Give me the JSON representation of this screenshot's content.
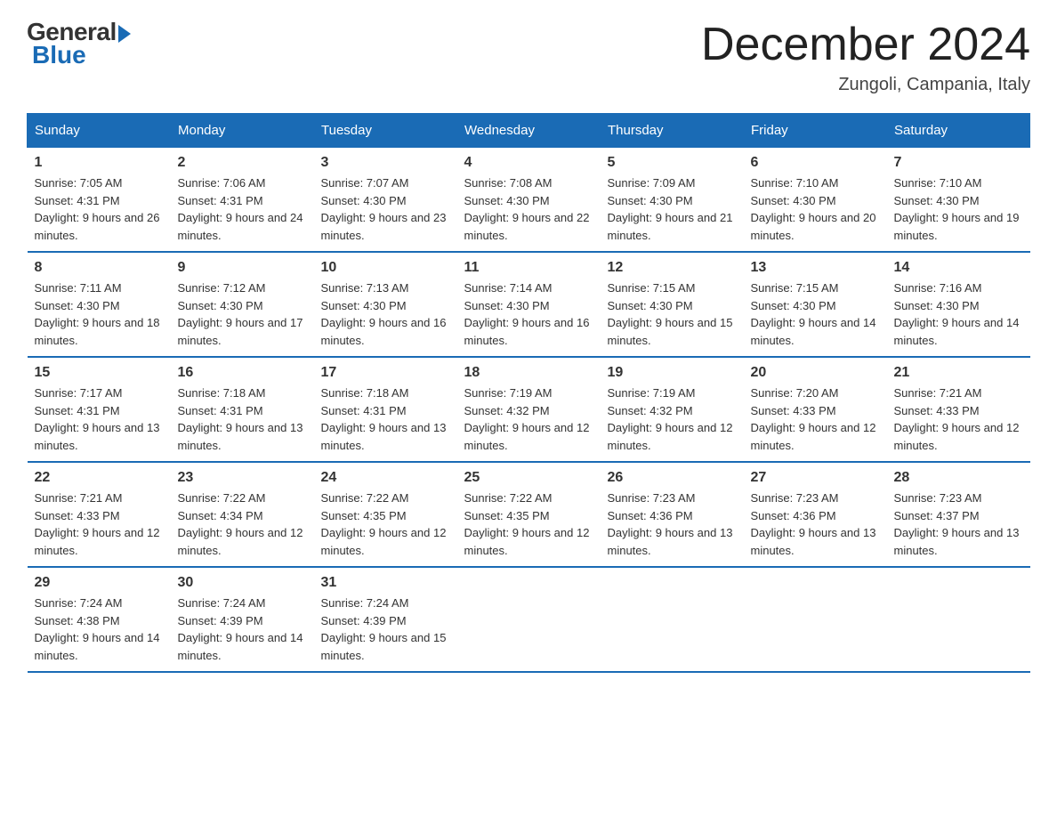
{
  "logo": {
    "general": "General",
    "blue": "Blue"
  },
  "title": "December 2024",
  "location": "Zungoli, Campania, Italy",
  "days_of_week": [
    "Sunday",
    "Monday",
    "Tuesday",
    "Wednesday",
    "Thursday",
    "Friday",
    "Saturday"
  ],
  "weeks": [
    [
      {
        "day": "1",
        "sunrise": "7:05 AM",
        "sunset": "4:31 PM",
        "daylight": "9 hours and 26 minutes."
      },
      {
        "day": "2",
        "sunrise": "7:06 AM",
        "sunset": "4:31 PM",
        "daylight": "9 hours and 24 minutes."
      },
      {
        "day": "3",
        "sunrise": "7:07 AM",
        "sunset": "4:30 PM",
        "daylight": "9 hours and 23 minutes."
      },
      {
        "day": "4",
        "sunrise": "7:08 AM",
        "sunset": "4:30 PM",
        "daylight": "9 hours and 22 minutes."
      },
      {
        "day": "5",
        "sunrise": "7:09 AM",
        "sunset": "4:30 PM",
        "daylight": "9 hours and 21 minutes."
      },
      {
        "day": "6",
        "sunrise": "7:10 AM",
        "sunset": "4:30 PM",
        "daylight": "9 hours and 20 minutes."
      },
      {
        "day": "7",
        "sunrise": "7:10 AM",
        "sunset": "4:30 PM",
        "daylight": "9 hours and 19 minutes."
      }
    ],
    [
      {
        "day": "8",
        "sunrise": "7:11 AM",
        "sunset": "4:30 PM",
        "daylight": "9 hours and 18 minutes."
      },
      {
        "day": "9",
        "sunrise": "7:12 AM",
        "sunset": "4:30 PM",
        "daylight": "9 hours and 17 minutes."
      },
      {
        "day": "10",
        "sunrise": "7:13 AM",
        "sunset": "4:30 PM",
        "daylight": "9 hours and 16 minutes."
      },
      {
        "day": "11",
        "sunrise": "7:14 AM",
        "sunset": "4:30 PM",
        "daylight": "9 hours and 16 minutes."
      },
      {
        "day": "12",
        "sunrise": "7:15 AM",
        "sunset": "4:30 PM",
        "daylight": "9 hours and 15 minutes."
      },
      {
        "day": "13",
        "sunrise": "7:15 AM",
        "sunset": "4:30 PM",
        "daylight": "9 hours and 14 minutes."
      },
      {
        "day": "14",
        "sunrise": "7:16 AM",
        "sunset": "4:30 PM",
        "daylight": "9 hours and 14 minutes."
      }
    ],
    [
      {
        "day": "15",
        "sunrise": "7:17 AM",
        "sunset": "4:31 PM",
        "daylight": "9 hours and 13 minutes."
      },
      {
        "day": "16",
        "sunrise": "7:18 AM",
        "sunset": "4:31 PM",
        "daylight": "9 hours and 13 minutes."
      },
      {
        "day": "17",
        "sunrise": "7:18 AM",
        "sunset": "4:31 PM",
        "daylight": "9 hours and 13 minutes."
      },
      {
        "day": "18",
        "sunrise": "7:19 AM",
        "sunset": "4:32 PM",
        "daylight": "9 hours and 12 minutes."
      },
      {
        "day": "19",
        "sunrise": "7:19 AM",
        "sunset": "4:32 PM",
        "daylight": "9 hours and 12 minutes."
      },
      {
        "day": "20",
        "sunrise": "7:20 AM",
        "sunset": "4:33 PM",
        "daylight": "9 hours and 12 minutes."
      },
      {
        "day": "21",
        "sunrise": "7:21 AM",
        "sunset": "4:33 PM",
        "daylight": "9 hours and 12 minutes."
      }
    ],
    [
      {
        "day": "22",
        "sunrise": "7:21 AM",
        "sunset": "4:33 PM",
        "daylight": "9 hours and 12 minutes."
      },
      {
        "day": "23",
        "sunrise": "7:22 AM",
        "sunset": "4:34 PM",
        "daylight": "9 hours and 12 minutes."
      },
      {
        "day": "24",
        "sunrise": "7:22 AM",
        "sunset": "4:35 PM",
        "daylight": "9 hours and 12 minutes."
      },
      {
        "day": "25",
        "sunrise": "7:22 AM",
        "sunset": "4:35 PM",
        "daylight": "9 hours and 12 minutes."
      },
      {
        "day": "26",
        "sunrise": "7:23 AM",
        "sunset": "4:36 PM",
        "daylight": "9 hours and 13 minutes."
      },
      {
        "day": "27",
        "sunrise": "7:23 AM",
        "sunset": "4:36 PM",
        "daylight": "9 hours and 13 minutes."
      },
      {
        "day": "28",
        "sunrise": "7:23 AM",
        "sunset": "4:37 PM",
        "daylight": "9 hours and 13 minutes."
      }
    ],
    [
      {
        "day": "29",
        "sunrise": "7:24 AM",
        "sunset": "4:38 PM",
        "daylight": "9 hours and 14 minutes."
      },
      {
        "day": "30",
        "sunrise": "7:24 AM",
        "sunset": "4:39 PM",
        "daylight": "9 hours and 14 minutes."
      },
      {
        "day": "31",
        "sunrise": "7:24 AM",
        "sunset": "4:39 PM",
        "daylight": "9 hours and 15 minutes."
      },
      null,
      null,
      null,
      null
    ]
  ]
}
